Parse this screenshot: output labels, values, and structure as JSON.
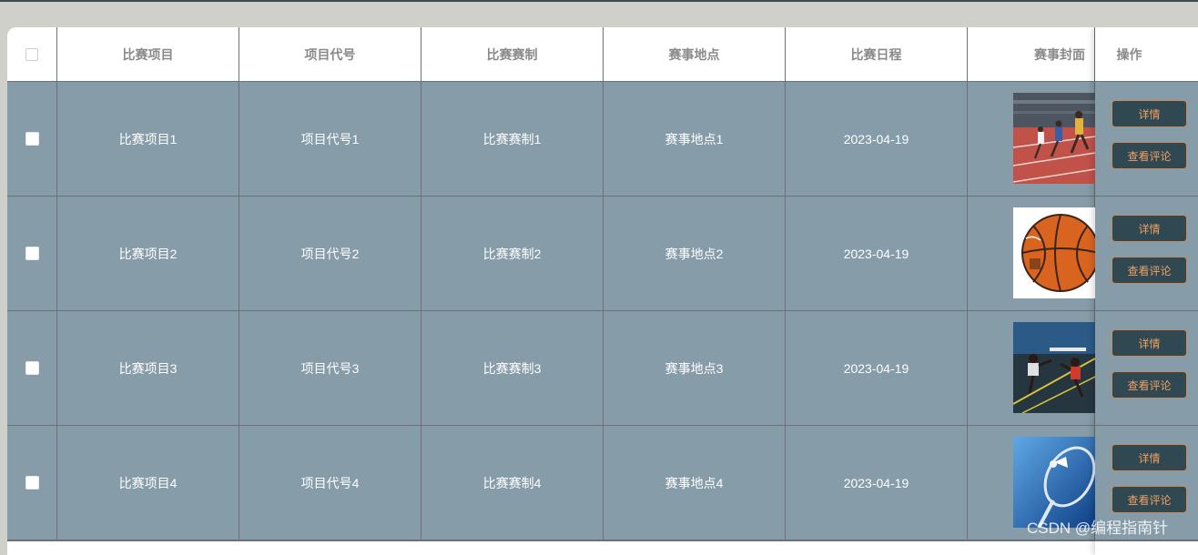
{
  "table": {
    "columns": [
      "比赛项目",
      "项目代号",
      "比赛赛制",
      "赛事地点",
      "比赛日程",
      "赛事封面",
      "操作"
    ],
    "rows": [
      {
        "project": "比赛项目1",
        "code": "项目代号1",
        "format": "比赛赛制1",
        "location": "赛事地点1",
        "date": "2023-04-19",
        "cover": "running-race-photo"
      },
      {
        "project": "比赛项目2",
        "code": "项目代号2",
        "format": "比赛赛制2",
        "location": "赛事地点2",
        "date": "2023-04-19",
        "cover": "basketball-photo"
      },
      {
        "project": "比赛项目3",
        "code": "项目代号3",
        "format": "比赛赛制3",
        "location": "赛事地点3",
        "date": "2023-04-19",
        "cover": "hurdles-photo"
      },
      {
        "project": "比赛项目4",
        "code": "项目代号4",
        "format": "比赛赛制4",
        "location": "赛事地点4",
        "date": "2023-04-19",
        "cover": "badminton-photo"
      }
    ],
    "actions": {
      "detail": "详情",
      "comments": "查看评论"
    }
  },
  "watermark": "CSDN @编程指南针",
  "colors": {
    "row_bg": "#869ca8",
    "button_bg": "#2f4852",
    "button_text": "#f0a060",
    "header_text": "#8a8a8a"
  }
}
